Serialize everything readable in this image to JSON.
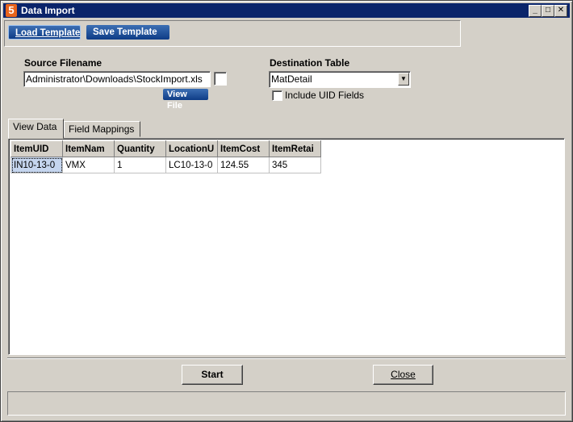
{
  "window": {
    "title": "Data Import",
    "icon_glyph": "5",
    "minimize_glyph": "_",
    "maximize_glyph": "□",
    "close_glyph": "✕"
  },
  "toolbar": {
    "load_template_label": "Load Template",
    "save_template_label": "Save Template"
  },
  "source": {
    "label": "Source Filename",
    "value": "Administrator\\Downloads\\StockImport.xls",
    "view_file_label": "View File"
  },
  "destination": {
    "label": "Destination Table",
    "selected": "MatDetail",
    "include_uid_label": "Include UID Fields",
    "include_uid_checked": false
  },
  "tabs": [
    {
      "label": "View Data",
      "active": true
    },
    {
      "label": "Field Mappings",
      "active": false
    }
  ],
  "grid": {
    "columns": [
      "ItemUID",
      "ItemNam",
      "Quantity",
      "LocationU",
      "ItemCost",
      "ItemRetai"
    ],
    "rows": [
      [
        "IN10-13-0",
        "VMX",
        "1",
        "LC10-13-0",
        "124.55",
        "345"
      ]
    ]
  },
  "buttons": {
    "start_label": "Start",
    "close_label": "Close"
  },
  "colors": {
    "title_bar": "#0a246a",
    "button_blue": "#0e3c86",
    "selected_cell": "#c5d5ee",
    "window_bg": "#d4d0c8"
  }
}
